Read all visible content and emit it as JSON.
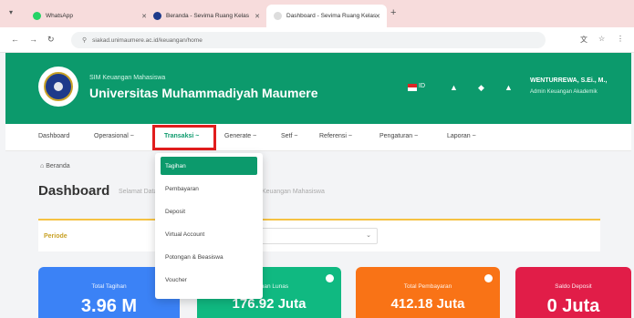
{
  "browser": {
    "tabs": [
      {
        "title": "WhatsApp"
      },
      {
        "title": "Beranda - Sevima Ruang Kelas"
      },
      {
        "title": "Dashboard - Sevima Ruang Kelas"
      }
    ],
    "url": "siakad.unimaumere.ac.id/keuangan/home"
  },
  "header": {
    "sub_brand": "SIM Keuangan Mahasiswa",
    "brand": "Universitas Muhammadiyah Maumere",
    "lang": "ID",
    "user_name": "WENTURREWA, S.Ei., M.,",
    "user_role": "Admin Keuangan Akademik"
  },
  "nav": {
    "items": [
      "Dashboard",
      "Operasional ~",
      "Transaksi ~",
      "Generate ~",
      "Setf ~",
      "Referensi ~",
      "Pengaturan ~",
      "Laporan ~"
    ]
  },
  "breadcrumb": "Beranda",
  "page": {
    "title": "Dashboard",
    "subtitle_left": "Selamat Datang di",
    "subtitle_right": "Keuangan Mahasiswa"
  },
  "filter": {
    "label": "Periode"
  },
  "dropdown": {
    "items": [
      "Tagihan",
      "Pembayaran",
      "Deposit",
      "Virtual Account",
      "Potongan & Beasiswa",
      "Voucher"
    ],
    "active_index": 0
  },
  "cards": [
    {
      "label": "Total Tagihan",
      "value": "3.96 M",
      "color": "#3b82f6"
    },
    {
      "label": "Tagihan Lunas",
      "value": "176.92 Juta",
      "color": "#10b981"
    },
    {
      "label": "Total Pembayaran",
      "value": "412.18 Juta",
      "color": "#f97316"
    },
    {
      "label": "Saldo Deposit",
      "value": "0 Juta",
      "color": "#e11d48"
    }
  ],
  "colors": {
    "header_green": "#0c9a6c",
    "highlight_red": "#e11d1d",
    "active_item": "#0c9a6c"
  }
}
